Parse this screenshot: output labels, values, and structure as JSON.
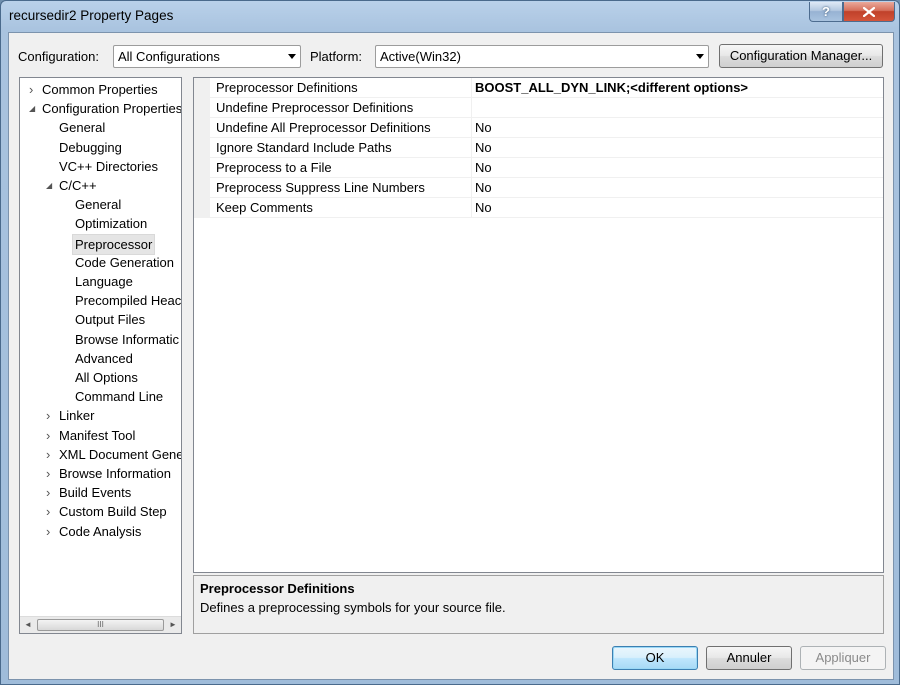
{
  "window": {
    "title": "recursedir2 Property Pages",
    "help_label": "?",
    "close_label": "x"
  },
  "toolbar": {
    "configuration_label": "Configuration:",
    "configuration_value": "All Configurations",
    "platform_label": "Platform:",
    "platform_value": "Active(Win32)",
    "config_manager_label": "Configuration Manager..."
  },
  "tree": {
    "items": [
      {
        "label": "Common Properties",
        "level": 0,
        "expander": "collapsed"
      },
      {
        "label": "Configuration Properties",
        "level": 0,
        "expander": "expanded"
      },
      {
        "label": "General",
        "level": 1,
        "expander": "none"
      },
      {
        "label": "Debugging",
        "level": 1,
        "expander": "none"
      },
      {
        "label": "VC++ Directories",
        "level": 1,
        "expander": "none"
      },
      {
        "label": "C/C++",
        "level": 1,
        "expander": "expanded"
      },
      {
        "label": "General",
        "level": 2,
        "expander": "none"
      },
      {
        "label": "Optimization",
        "level": 2,
        "expander": "none"
      },
      {
        "label": "Preprocessor",
        "level": 2,
        "expander": "none",
        "selected": true
      },
      {
        "label": "Code Generation",
        "level": 2,
        "expander": "none"
      },
      {
        "label": "Language",
        "level": 2,
        "expander": "none"
      },
      {
        "label": "Precompiled Heac",
        "level": 2,
        "expander": "none"
      },
      {
        "label": "Output Files",
        "level": 2,
        "expander": "none"
      },
      {
        "label": "Browse Informatic",
        "level": 2,
        "expander": "none"
      },
      {
        "label": "Advanced",
        "level": 2,
        "expander": "none"
      },
      {
        "label": "All Options",
        "level": 2,
        "expander": "none"
      },
      {
        "label": "Command Line",
        "level": 2,
        "expander": "none"
      },
      {
        "label": "Linker",
        "level": 1,
        "expander": "collapsed"
      },
      {
        "label": "Manifest Tool",
        "level": 1,
        "expander": "collapsed"
      },
      {
        "label": "XML Document Gene",
        "level": 1,
        "expander": "collapsed"
      },
      {
        "label": "Browse Information",
        "level": 1,
        "expander": "collapsed"
      },
      {
        "label": "Build Events",
        "level": 1,
        "expander": "collapsed"
      },
      {
        "label": "Custom Build Step",
        "level": 1,
        "expander": "collapsed"
      },
      {
        "label": "Code Analysis",
        "level": 1,
        "expander": "collapsed"
      }
    ],
    "scroll_thumb_glyph": "III"
  },
  "properties": [
    {
      "name": "Preprocessor Definitions",
      "value": "BOOST_ALL_DYN_LINK;<different options>",
      "bold": true
    },
    {
      "name": "Undefine Preprocessor Definitions",
      "value": "",
      "bold": false
    },
    {
      "name": "Undefine All Preprocessor Definitions",
      "value": "No",
      "bold": false
    },
    {
      "name": "Ignore Standard Include Paths",
      "value": "No",
      "bold": false
    },
    {
      "name": "Preprocess to a File",
      "value": "No",
      "bold": false
    },
    {
      "name": "Preprocess Suppress Line Numbers",
      "value": "No",
      "bold": false
    },
    {
      "name": "Keep Comments",
      "value": "No",
      "bold": false
    }
  ],
  "description": {
    "title": "Preprocessor Definitions",
    "text": "Defines a preprocessing symbols for your source file."
  },
  "footer": {
    "ok_label": "OK",
    "cancel_label": "Annuler",
    "apply_label": "Appliquer"
  }
}
